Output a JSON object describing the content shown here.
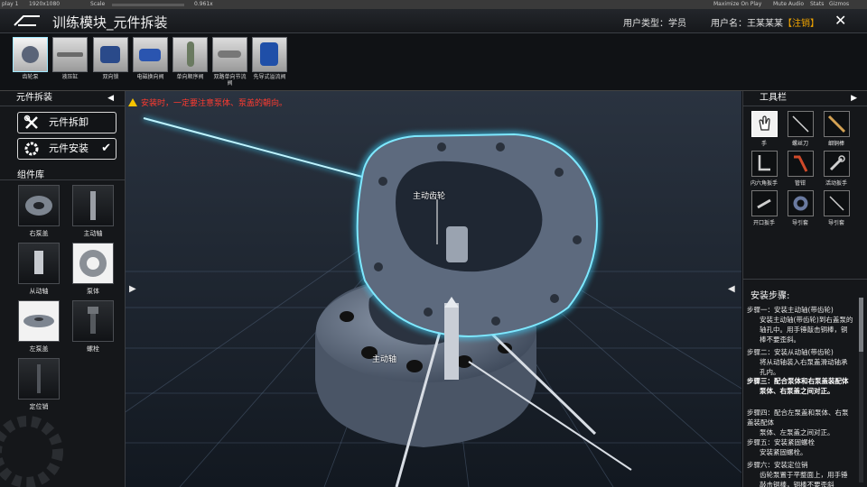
{
  "unity_bar": {
    "display": "play 1",
    "resolution": "1920x1080",
    "scale_label": "Scale",
    "scale_value": "0.961x",
    "maximize": "Maximize On Play",
    "mute": "Mute Audio",
    "stats": "Stats",
    "gizmos": "Gizmos"
  },
  "header": {
    "title": "训练模块_元件拆装",
    "user_type": "用户类型：学员",
    "user_name": "用户名：王某某某",
    "logout": "【注销】",
    "close": "✕"
  },
  "components": [
    {
      "label": "齿轮泵",
      "active": true
    },
    {
      "label": "液压缸"
    },
    {
      "label": "双向锁"
    },
    {
      "label": "电磁换向阀"
    },
    {
      "label": "单向顺序阀"
    },
    {
      "label": "双路单向节流阀"
    },
    {
      "label": "先导式溢流阀"
    }
  ],
  "left_panel": {
    "title": "元件拆装",
    "disassemble_label": "元件拆卸",
    "assemble_label": "元件安装",
    "library_title": "组件库",
    "library": [
      {
        "label": "右泵盖"
      },
      {
        "label": "主动轴"
      },
      {
        "label": "从动轴"
      },
      {
        "label": "泵体"
      },
      {
        "label": "左泵盖"
      },
      {
        "label": "螺栓"
      },
      {
        "label": "定位销"
      }
    ]
  },
  "viewport": {
    "warning": "安装时，一定要注意泵体、泵盖的朝向。",
    "label_gear": "主动齿轮",
    "label_shaft": "主动轴",
    "colors": {
      "glow": "#3fd6ff",
      "grid_bg": "#1b2330",
      "grid_line": "#5a6f8a"
    }
  },
  "right_panel": {
    "title": "工具栏",
    "tools": [
      {
        "label": "手",
        "icon": "hand-icon",
        "active": true
      },
      {
        "label": "螺丝刀",
        "icon": "screwdriver-icon"
      },
      {
        "label": "细铜棒",
        "icon": "copper-rod-icon"
      },
      {
        "label": "内六角扳手",
        "icon": "hex-key-icon"
      },
      {
        "label": "管钳",
        "icon": "pipe-wrench-icon"
      },
      {
        "label": "活动扳手",
        "icon": "adjustable-wrench-icon"
      },
      {
        "label": "开口扳手",
        "icon": "open-wrench-icon"
      },
      {
        "label": "导引套",
        "icon": "guide-sleeve-icon"
      },
      {
        "label": "导引套",
        "icon": "guide-rod-icon"
      }
    ],
    "steps_title": "安装步骤:",
    "steps": [
      {
        "title": "步骤一：安装主动轴(带齿轮)",
        "body": "安装主动轴(带齿轮)到右盖泵的轴孔中。用手锤敲击铜棒，铜棒不要歪斜。"
      },
      {
        "title": "步骤二：安装从动轴(带齿轮)",
        "body": "将从动轴装入右泵盖滑动轴承孔内。"
      },
      {
        "title": "步骤三：配合泵体和右泵盖装配体",
        "body": "泵体、右泵盖之间对正。",
        "bold": true
      },
      {
        "title": "步骤四：配合左泵盖和泵体、右泵盖装配体",
        "body": "泵体、左泵盖之间对正。"
      },
      {
        "title": "步骤五：安装紧固螺栓",
        "body": "安装紧固螺栓。"
      },
      {
        "title": "步骤六：安装定位销",
        "body": "齿轮泵置于平整面上，用手锤敲击铜棒，铜棒不要歪斜"
      }
    ]
  },
  "colors": {
    "accent": "#f0a400",
    "warning": "#ff3b30",
    "panel_bg": "#15171a"
  }
}
